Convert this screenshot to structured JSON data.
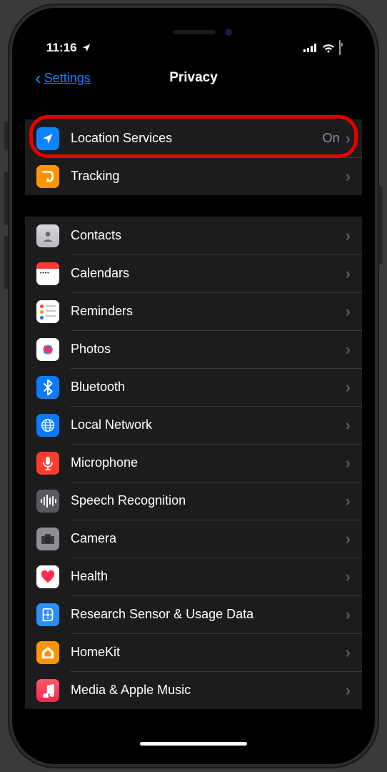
{
  "status": {
    "time": "11:16",
    "location_indicator": "navigation-arrow-icon"
  },
  "nav": {
    "back_label": "Settings",
    "title": "Privacy"
  },
  "groups": [
    {
      "rows": [
        {
          "icon": "location",
          "label": "Location Services",
          "value": "On",
          "highlighted": true
        },
        {
          "icon": "tracking",
          "label": "Tracking",
          "value": ""
        }
      ]
    },
    {
      "rows": [
        {
          "icon": "contacts",
          "label": "Contacts",
          "value": ""
        },
        {
          "icon": "calendar",
          "label": "Calendars",
          "value": ""
        },
        {
          "icon": "reminders",
          "label": "Reminders",
          "value": ""
        },
        {
          "icon": "photos",
          "label": "Photos",
          "value": ""
        },
        {
          "icon": "bluetooth",
          "label": "Bluetooth",
          "value": ""
        },
        {
          "icon": "localnet",
          "label": "Local Network",
          "value": ""
        },
        {
          "icon": "microphone",
          "label": "Microphone",
          "value": ""
        },
        {
          "icon": "speech",
          "label": "Speech Recognition",
          "value": ""
        },
        {
          "icon": "camera",
          "label": "Camera",
          "value": ""
        },
        {
          "icon": "health",
          "label": "Health",
          "value": ""
        },
        {
          "icon": "research",
          "label": "Research Sensor & Usage Data",
          "value": ""
        },
        {
          "icon": "homekit",
          "label": "HomeKit",
          "value": ""
        },
        {
          "icon": "music",
          "label": "Media & Apple Music",
          "value": ""
        }
      ]
    }
  ]
}
